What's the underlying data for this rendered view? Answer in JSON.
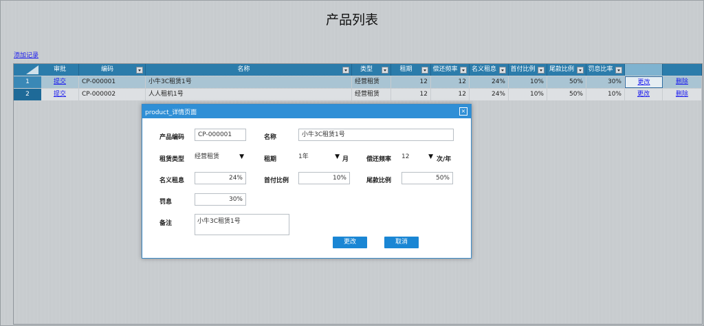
{
  "page": {
    "title": "产品列表",
    "add_link": "添加记录"
  },
  "grid": {
    "columns": [
      "审批",
      "编码",
      "名称",
      "类型",
      "租期",
      "偿还频率",
      "名义租息",
      "首付比例",
      "尾款比例",
      "罚息比率",
      "",
      ""
    ],
    "rows": [
      {
        "num": "1",
        "approve": "提交",
        "code": "CP-000001",
        "name": "小牛3C租赁1号",
        "type": "经营租赁",
        "term": "12",
        "freq": "12",
        "rate": "24%",
        "down": "10%",
        "tail": "50%",
        "penalty": "30%",
        "edit": "更改",
        "delete": "删除"
      },
      {
        "num": "2",
        "approve": "提交",
        "code": "CP-000002",
        "name": "人人租机1号",
        "type": "经营租赁",
        "term": "12",
        "freq": "12",
        "rate": "24%",
        "down": "10%",
        "tail": "50%",
        "penalty": "10%",
        "edit": "更改",
        "delete": "删除"
      }
    ]
  },
  "dialog": {
    "title": "product_详情页面",
    "close": "×",
    "labels": {
      "code": "产品编码",
      "name": "名称",
      "type": "租赁类型",
      "term": "租期",
      "freq": "偿还频率",
      "rate": "名义租息",
      "down": "首付比例",
      "tail": "尾款比例",
      "penalty": "罚息",
      "remark": "备注"
    },
    "values": {
      "code": "CP-000001",
      "name": "小牛3C租赁1号",
      "type": "经营租赁",
      "term": "1年",
      "freq": "12",
      "rate": "24%",
      "down": "10%",
      "tail": "50%",
      "penalty": "30%",
      "remark": "小牛3C租赁1号"
    },
    "units": {
      "term": "月",
      "freq": "次/年"
    },
    "dropdown_arrow": "▼",
    "buttons": {
      "save": "更改",
      "cancel": "取消"
    }
  },
  "colors": {
    "header": "#2b7cab",
    "selected_row": "#a9c4d3",
    "row": "#dde0e3",
    "dialog_header": "#2f8fd6",
    "button": "#1a86d4"
  }
}
